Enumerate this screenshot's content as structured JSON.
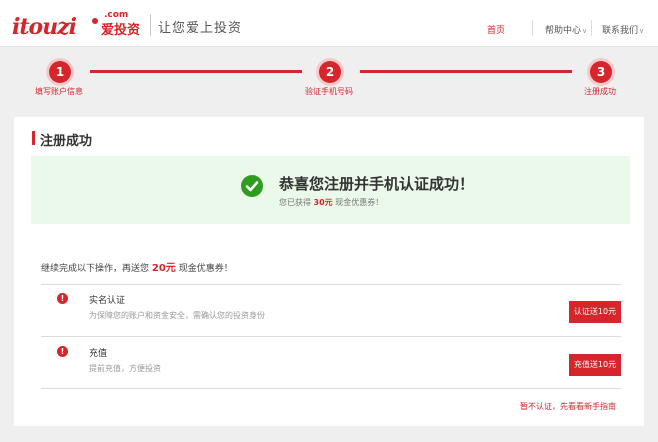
{
  "header": {
    "logo_text": "itouzi",
    "logo_com": ".com",
    "logo_cn": "爱投资",
    "slogan": "让您爱上投资",
    "nav": {
      "home": "首页",
      "help": "帮助中心",
      "contact": "联系我们"
    }
  },
  "steps": [
    {
      "number": "1",
      "label": "填写账户信息"
    },
    {
      "number": "2",
      "label": "验证手机号码"
    },
    {
      "number": "3",
      "label": "注册成功"
    }
  ],
  "card": {
    "title": "注册成功",
    "success": {
      "title": "恭喜您注册并手机认证成功！",
      "sub_prefix": "您已获得",
      "sub_amount": "30元",
      "sub_suffix": "现金优惠券！"
    },
    "continue": {
      "prefix": "继续完成以下操作，再送您",
      "amount": "20元",
      "suffix": "现金优惠券！"
    },
    "tasks": [
      {
        "title": "实名认证",
        "desc": "为保障您的账户和资金安全，需确认您的投资身份",
        "button": "认证送10元"
      },
      {
        "title": "充值",
        "desc": "提前充值，方便投资",
        "button": "充值送10元"
      }
    ],
    "skip_link": "暂不认证，先看看新手指南"
  },
  "colors": {
    "accent": "#d6252b",
    "success_bg": "#eaf9e9",
    "check_green": "#2e9c1f",
    "page_bg": "#f0eff0"
  }
}
